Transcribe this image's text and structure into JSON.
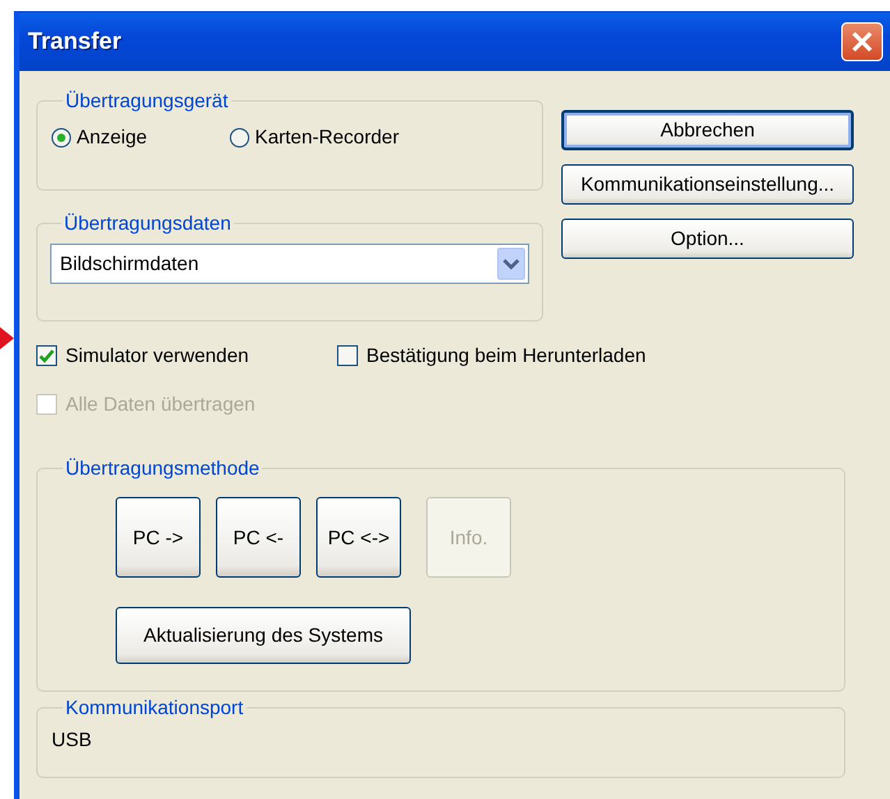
{
  "window": {
    "title": "Transfer"
  },
  "device_group": {
    "label": "Übertragungsgerät",
    "options": [
      {
        "label": "Anzeige",
        "selected": true
      },
      {
        "label": "Karten-Recorder",
        "selected": false
      }
    ]
  },
  "data_group": {
    "label": "Übertragungsdaten",
    "value": "Bildschirmdaten"
  },
  "side_buttons": [
    {
      "label": "Abbrechen",
      "default": true
    },
    {
      "label": "Kommunikationseinstellung...",
      "default": false
    },
    {
      "label": "Option...",
      "default": false
    }
  ],
  "checkboxes": [
    {
      "label": "Simulator verwenden",
      "checked": true,
      "disabled": false
    },
    {
      "label": "Bestätigung beim Herunterladen",
      "checked": false,
      "disabled": false
    },
    {
      "label": "Alle Daten übertragen",
      "checked": false,
      "disabled": true
    }
  ],
  "method_group": {
    "label": "Übertragungsmethode",
    "buttons": [
      {
        "label": "PC ->",
        "disabled": false
      },
      {
        "label": "PC <-",
        "disabled": false
      },
      {
        "label": "PC <->",
        "disabled": false
      },
      {
        "label": "Info.",
        "disabled": true
      }
    ],
    "update_button": "Aktualisierung des Systems"
  },
  "port_group": {
    "label": "Kommunikationsport",
    "value": "USB"
  }
}
